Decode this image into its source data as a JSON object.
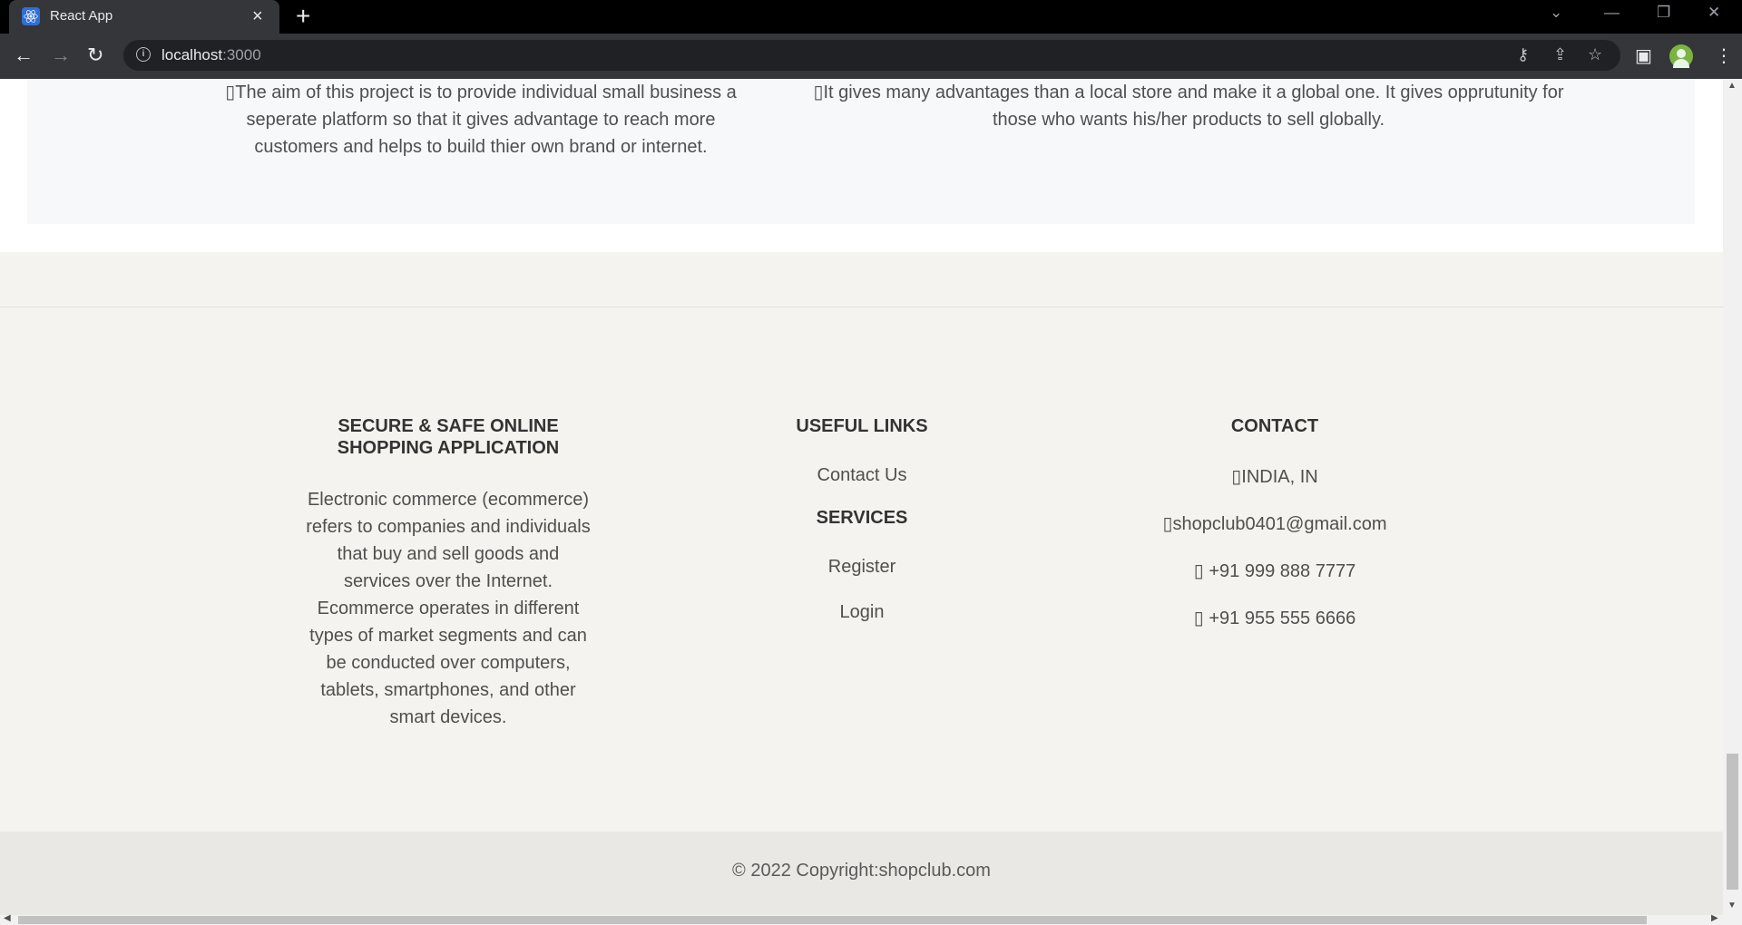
{
  "browser": {
    "tab_title": "React App",
    "url_host": "localhost",
    "url_port": ":3000"
  },
  "about": {
    "left_text": "The aim of this project is to provide individual small business a seperate platform so that it gives advantage to reach more customers and helps to build thier own brand or internet.",
    "right_text": "It gives many advantages than a local store and make it a global one. It gives opprutunity for those who wants his/her products to sell globally."
  },
  "footer": {
    "about_title_line1": "SECURE & SAFE ONLINE",
    "about_title_line2": "SHOPPING APPLICATION",
    "about_text": "Electronic commerce (ecommerce) refers to companies and individuals that buy and sell goods and services over the Internet. Ecommerce operates in different types of market segments and can be conducted over computers, tablets, smartphones, and other smart devices.",
    "useful_links_title": "USEFUL LINKS",
    "contact_us": "Contact Us",
    "services_title": "SERVICES",
    "register": "Register",
    "login": "Login",
    "contact_title": "CONTACT",
    "location": "INDIA, IN",
    "email": "shopclub0401@gmail.com",
    "phone1": " +91 999 888 7777",
    "phone2": " +91 955 555 6666",
    "copyright": "© 2022 Copyright:shopclub.com"
  },
  "icons": {
    "favicon": "react-icon",
    "missing_glyph": "▯"
  }
}
